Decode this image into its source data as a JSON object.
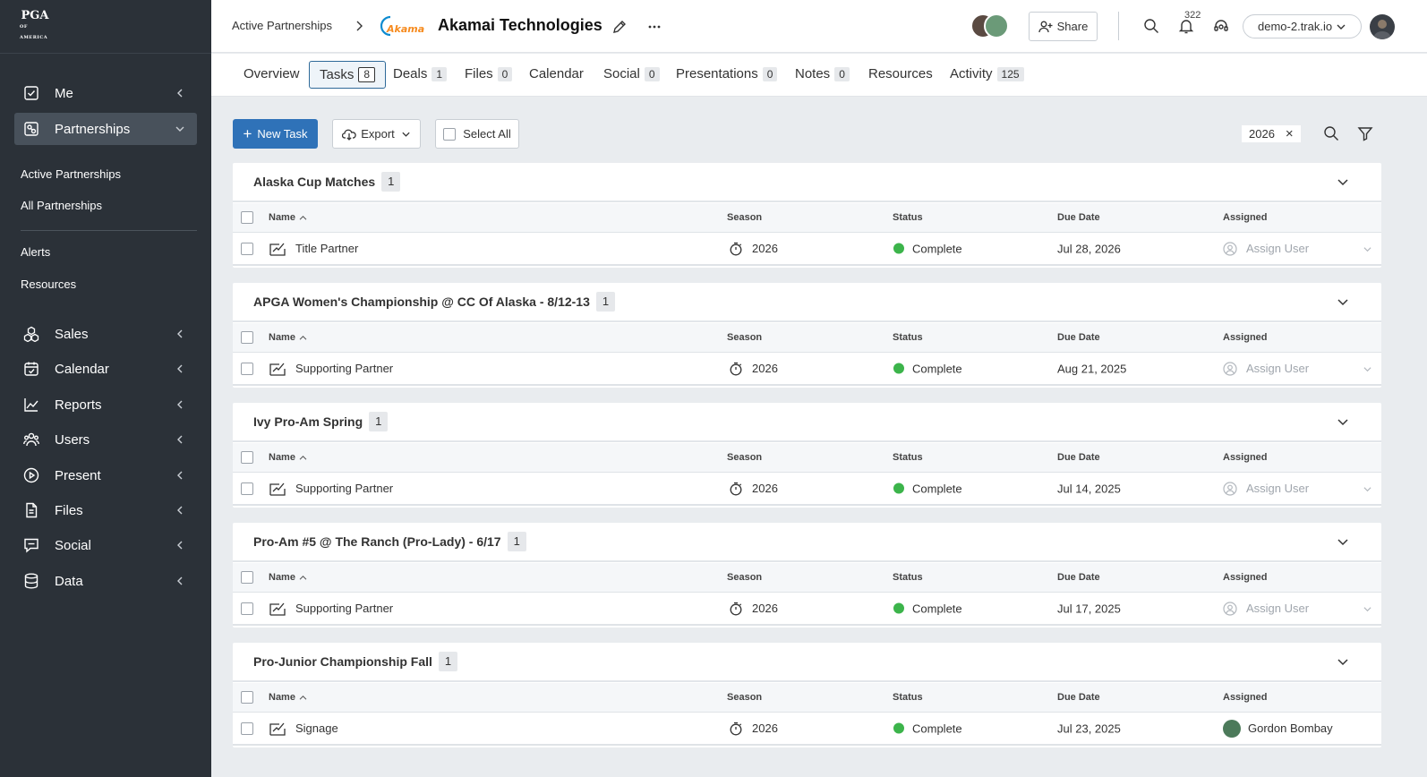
{
  "sidebar": {
    "logo": {
      "line1": "PGA",
      "line2": "OF AMERICA"
    },
    "nav": [
      {
        "label": "Me",
        "icon": "checkbox-icon"
      },
      {
        "label": "Partnerships",
        "icon": "handshake-icon"
      },
      {
        "label": "Sales",
        "icon": "boxes-icon"
      },
      {
        "label": "Calendar",
        "icon": "calendar-icon"
      },
      {
        "label": "Reports",
        "icon": "chart-icon"
      },
      {
        "label": "Users",
        "icon": "users-icon"
      },
      {
        "label": "Present",
        "icon": "play-icon"
      },
      {
        "label": "Files",
        "icon": "file-icon"
      },
      {
        "label": "Social",
        "icon": "chat-icon"
      },
      {
        "label": "Data",
        "icon": "database-icon"
      }
    ],
    "sub": [
      "Active Partnerships",
      "All Partnerships",
      "Alerts",
      "Resources"
    ]
  },
  "header": {
    "breadcrumb": "Active Partnerships",
    "brand_logo_text": "Akamai",
    "company": "Akamai Technologies",
    "share_label": "Share",
    "notifications": "322",
    "org": "demo-2.trak.io"
  },
  "tabs": [
    {
      "label": "Overview",
      "count": ""
    },
    {
      "label": "Tasks",
      "count": "8"
    },
    {
      "label": "Deals",
      "count": "1"
    },
    {
      "label": "Files",
      "count": "0"
    },
    {
      "label": "Calendar",
      "count": ""
    },
    {
      "label": "Social",
      "count": "0"
    },
    {
      "label": "Presentations",
      "count": "0"
    },
    {
      "label": "Notes",
      "count": "0"
    },
    {
      "label": "Resources",
      "count": ""
    },
    {
      "label": "Activity",
      "count": "125"
    }
  ],
  "toolbar": {
    "new_task": "New Task",
    "export": "Export",
    "select_all": "Select All",
    "filter_chip": "2026"
  },
  "columns": {
    "name": "Name",
    "season": "Season",
    "status": "Status",
    "due": "Due Date",
    "assigned": "Assigned"
  },
  "groups": [
    {
      "title": "Alaska Cup Matches",
      "count": "1",
      "task": {
        "name": "Title Partner",
        "season": "2026",
        "status": "Complete",
        "due": "Jul 28, 2026",
        "assigned": "Assign User"
      }
    },
    {
      "title": "APGA Women's Championship @ CC Of Alaska - 8/12-13",
      "count": "1",
      "task": {
        "name": "Supporting Partner",
        "season": "2026",
        "status": "Complete",
        "due": "Aug 21, 2025",
        "assigned": "Assign User"
      }
    },
    {
      "title": "Ivy Pro-Am Spring",
      "count": "1",
      "task": {
        "name": "Supporting Partner",
        "season": "2026",
        "status": "Complete",
        "due": "Jul 14, 2025",
        "assigned": "Assign User"
      }
    },
    {
      "title": "Pro-Am #5 @ The Ranch (Pro-Lady) - 6/17",
      "count": "1",
      "task": {
        "name": "Supporting Partner",
        "season": "2026",
        "status": "Complete",
        "due": "Jul 17, 2025",
        "assigned": "Assign User"
      }
    },
    {
      "title": "Pro-Junior Championship Fall",
      "count": "1",
      "task": {
        "name": "Signage",
        "season": "2026",
        "status": "Complete",
        "due": "Jul 23, 2025",
        "assigned": "Gordon Bombay"
      }
    }
  ],
  "colors": {
    "primary": "#2f72b8",
    "sidebar": "#2b3138",
    "complete": "#3cb44b"
  }
}
